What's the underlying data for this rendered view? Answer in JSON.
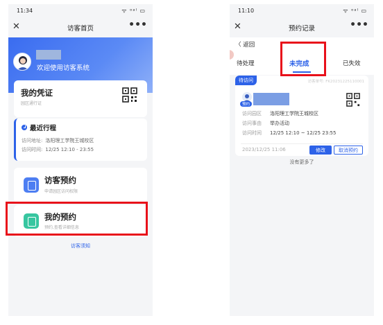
{
  "left": {
    "status_time": "11:34",
    "status_icons": "ᯤ ᵒᵃˡ ▭",
    "nav_close": "✕",
    "nav_title": "访客首页",
    "nav_more": "•••",
    "welcome": "欢迎使用访客系统",
    "credential": {
      "title": "我的凭证",
      "subtitle": "园区通行证"
    },
    "recent_trip": {
      "title": "最近行程",
      "address_label": "访问地址:",
      "address": "洛阳理工学院王城校区",
      "time_label": "访问时间:",
      "time": "12/25 12:10 - 23:55"
    },
    "visitor_booking": {
      "title": "访客预约",
      "subtitle": "申请园区访问权限"
    },
    "my_booking": {
      "title": "我的预约",
      "subtitle": "预约,查看详细信息"
    },
    "notice_link": "访客须知"
  },
  "right": {
    "status_time": "11:10",
    "status_icons": "ᯤ ᵒᵃˡ ▭",
    "nav_close": "✕",
    "nav_title": "预约记录",
    "nav_more": "•••",
    "back": "〈 返回",
    "tabs": [
      "待处理",
      "未完成",
      "已失效"
    ],
    "active_tab": "未完成",
    "record": {
      "status_badge": "待访问",
      "record_no": "访客单号: FK20231225110001",
      "avatar_badge": "预约",
      "rows": [
        {
          "label": "访问园区",
          "value": "洛阳理工学院王城校区"
        },
        {
          "label": "访问事由",
          "value": "举办活动"
        },
        {
          "label": "访问时间",
          "value": "12/25 12:10 ~ 12/25 23:55"
        }
      ],
      "created": "2023/12/25 11:06",
      "edit_button": "修改",
      "cancel_button": "取消预约"
    },
    "no_more": "没有更多了"
  },
  "colors": {
    "accent": "#2d62e8",
    "highlight": "#e8101a",
    "success": "#37c6a0"
  }
}
